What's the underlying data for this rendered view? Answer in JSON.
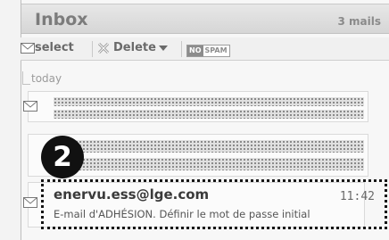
{
  "header": {
    "title": "Inbox",
    "count": "3 mails"
  },
  "toolbar": {
    "select_label": "select",
    "delete_label": "Delete",
    "nospam_no": "NO",
    "nospam_spam": "SPAM"
  },
  "group": {
    "label": "today"
  },
  "callout": {
    "number": "2"
  },
  "mail": {
    "sender": "enervu.ess@lge.com",
    "time": "11:42",
    "subject": "E-mail d'ADHÉSION. Définir le mot de passe initial"
  },
  "icons": {
    "select": "envelope-icon",
    "delete": "delete-x-icon",
    "mail_row": "envelope-icon"
  }
}
